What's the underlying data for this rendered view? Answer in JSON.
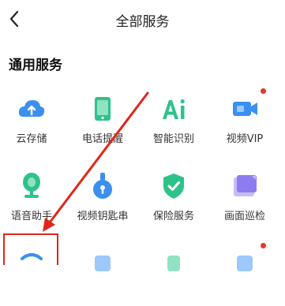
{
  "header": {
    "title": "全部服务"
  },
  "section": {
    "title": "通用服务"
  },
  "items": [
    {
      "label": "云存储",
      "icon": "cloud-upload-icon"
    },
    {
      "label": "电话提醒",
      "icon": "phone-icon"
    },
    {
      "label": "智能识别",
      "icon": "ai-icon"
    },
    {
      "label": "视频VIP",
      "icon": "video-vip-icon",
      "badge": true
    },
    {
      "label": "语音助手",
      "icon": "voice-assistant-icon"
    },
    {
      "label": "视频钥匙串",
      "icon": "video-key-icon"
    },
    {
      "label": "保险服务",
      "icon": "insurance-shield-icon"
    },
    {
      "label": "画面巡检",
      "icon": "screen-inspection-icon"
    }
  ],
  "colors": {
    "accent": "#2ec28b",
    "blue": "#3a8ff0",
    "purple": "#8d7cf0",
    "annotation": "#e0261c"
  }
}
